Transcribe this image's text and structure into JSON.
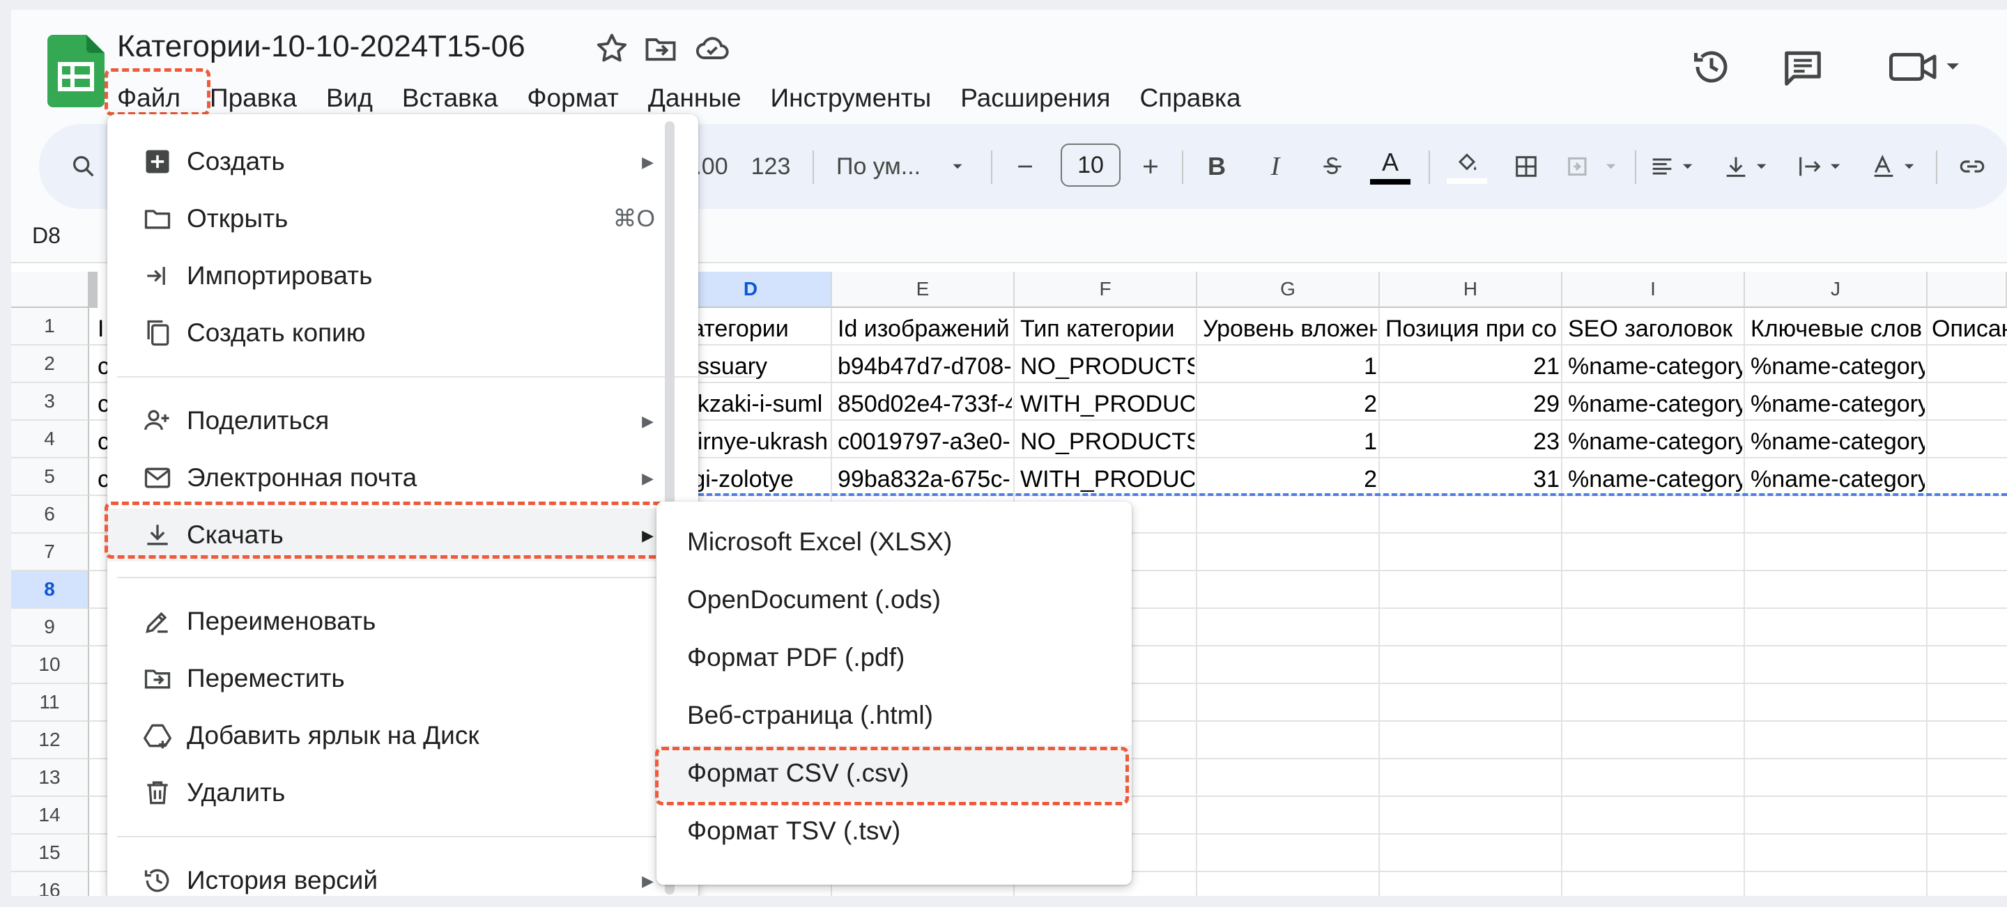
{
  "document": {
    "title": "Категории-10-10-2024T15-06"
  },
  "menubar": [
    "Файл",
    "Правка",
    "Вид",
    "Вставка",
    "Формат",
    "Данные",
    "Инструменты",
    "Расширения",
    "Справка"
  ],
  "toolbar": {
    "decimal_label": ".00",
    "format_label": "123",
    "font_name": "По ум...",
    "font_size": "10",
    "bold_label": "B",
    "italic_label": "I",
    "text_color_label": "A"
  },
  "namebox": "D8",
  "columns": [
    "D",
    "E",
    "F",
    "G",
    "H",
    "I",
    "J"
  ],
  "selected_column": "D",
  "rows": [
    "1",
    "2",
    "3",
    "4",
    "5",
    "6",
    "7",
    "8",
    "9",
    "10",
    "11",
    "12",
    "13",
    "14",
    "15",
    "16"
  ],
  "selected_row": "8",
  "cells": {
    "col_a_row1": "I",
    "col_a_rows": [
      "c",
      "c",
      "c",
      "c"
    ],
    "header_row": [
      "атегории",
      "Id изображений",
      "Тип категории",
      "Уровень вложен",
      "Позиция при со",
      "SEO заголовок",
      "Ключевые слов",
      "Описан"
    ],
    "data": [
      [
        "essuary",
        "b94b47d7-d708-",
        "NO_PRODUCTS",
        "1",
        "21",
        "%name-category",
        "%name-category%"
      ],
      [
        "ukzaki-i-suml",
        "850d02e4-733f-4",
        "WITH_PRODUC",
        "2",
        "29",
        "%name-category",
        "%name-category%"
      ],
      [
        "dirnye-ukrash",
        "c0019797-a3e0-",
        "NO_PRODUCTS",
        "1",
        "23",
        "%name-category",
        "%name-category%"
      ],
      [
        "rgi-zolotye",
        "99ba832a-675c-",
        "WITH_PRODUC",
        "2",
        "31",
        "%name-category",
        "%name-category%"
      ]
    ]
  },
  "file_menu": {
    "items": [
      {
        "label": "Создать",
        "icon": "plus-square-icon",
        "submenu": true
      },
      {
        "label": "Открыть",
        "icon": "folder-icon",
        "shortcut": "⌘O"
      },
      {
        "label": "Импортировать",
        "icon": "import-icon"
      },
      {
        "label": "Создать копию",
        "icon": "copy-icon"
      },
      {
        "label": "Поделиться",
        "icon": "person-add-icon",
        "submenu": true
      },
      {
        "label": "Электронная почта",
        "icon": "mail-icon",
        "submenu": true
      },
      {
        "label": "Скачать",
        "icon": "download-icon",
        "submenu": true
      },
      {
        "label": "Переименовать",
        "icon": "rename-icon"
      },
      {
        "label": "Переместить",
        "icon": "move-folder-icon"
      },
      {
        "label": "Добавить ярлык на Диск",
        "icon": "drive-shortcut-icon"
      },
      {
        "label": "Удалить",
        "icon": "trash-icon"
      },
      {
        "label": "История версий",
        "icon": "history-icon",
        "submenu": true
      }
    ]
  },
  "download_submenu": {
    "items": [
      "Microsoft Excel (XLSX)",
      "OpenDocument (.ods)",
      "Формат PDF (.pdf)",
      "Веб-страница (.html)",
      "Формат CSV (.csv)",
      "Формат TSV (.tsv)"
    ],
    "highlighted": "Формат CSV (.csv)"
  },
  "colors": {
    "accent": "#0b57d0",
    "highlight_box": "#ee5a3a",
    "logo_green": "#34a853",
    "toolbar_bg": "#edf2fa"
  }
}
